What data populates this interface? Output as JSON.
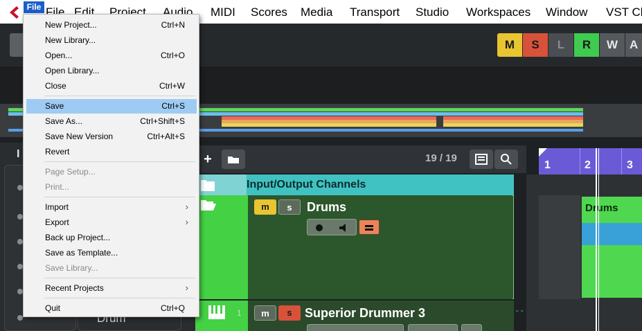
{
  "menubar": {
    "file_tag": "File",
    "items": [
      "File",
      "Edit",
      "Project",
      "Audio",
      "MIDI",
      "Scores",
      "Media",
      "Transport",
      "Studio",
      "Workspaces",
      "Window",
      "VST Cl"
    ]
  },
  "toolbar": {
    "buttons": [
      "M",
      "S",
      "L",
      "R",
      "W",
      "A"
    ]
  },
  "inspector": {
    "label": "I",
    "drum_text": "Drum"
  },
  "tracklist": {
    "count": "19 / 19",
    "io_label": "Input/Output Channels",
    "drums_name": "Drums",
    "superior_name": "Superior Drummer 3",
    "superior_num": "1",
    "m": "m",
    "s": "s"
  },
  "arrange": {
    "ruler": [
      "1",
      "2",
      "3"
    ],
    "event_label": "Drums",
    "dash": "--"
  },
  "file_menu": {
    "items": [
      {
        "label": "New Project...",
        "shortcut": "Ctrl+N"
      },
      {
        "label": "New Library...",
        "shortcut": ""
      },
      {
        "label": "Open...",
        "shortcut": "Ctrl+O"
      },
      {
        "label": "Open Library...",
        "shortcut": ""
      },
      {
        "label": "Close",
        "shortcut": "Ctrl+W"
      },
      {
        "label": "Save",
        "shortcut": "Ctrl+S"
      },
      {
        "label": "Save As...",
        "shortcut": "Ctrl+Shift+S"
      },
      {
        "label": "Save New Version",
        "shortcut": "Ctrl+Alt+S"
      },
      {
        "label": "Revert",
        "shortcut": ""
      },
      {
        "label": "Page Setup...",
        "shortcut": ""
      },
      {
        "label": "Print...",
        "shortcut": ""
      },
      {
        "label": "Import",
        "shortcut": ""
      },
      {
        "label": "Export",
        "shortcut": ""
      },
      {
        "label": "Back up Project...",
        "shortcut": ""
      },
      {
        "label": "Save as Template...",
        "shortcut": ""
      },
      {
        "label": "Save Library...",
        "shortcut": ""
      },
      {
        "label": "Recent Projects",
        "shortcut": ""
      },
      {
        "label": "Quit",
        "shortcut": "Ctrl+Q"
      }
    ]
  }
}
